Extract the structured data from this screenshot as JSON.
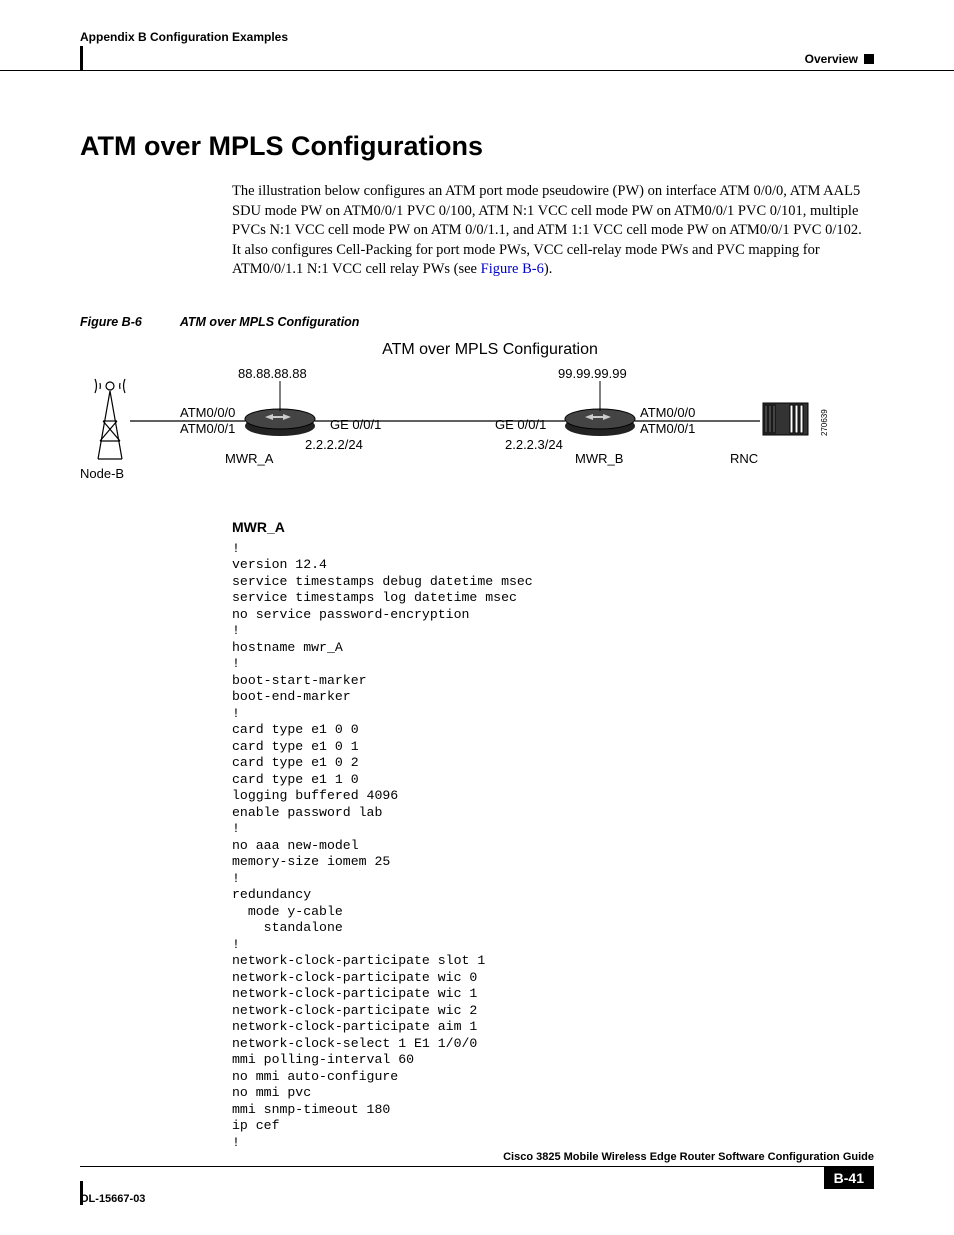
{
  "header": {
    "left": "Appendix B      Configuration Examples",
    "right": "Overview"
  },
  "heading": "ATM over MPLS Configurations",
  "intro_part1": "The illustration below configures an ATM port mode pseudowire (PW) on interface ATM 0/0/0, ATM AAL5 SDU mode PW on ATM0/0/1 PVC 0/100, ATM N:1 VCC cell mode PW on ATM0/0/1 PVC 0/101, multiple PVCs N:1 VCC cell mode PW on ATM 0/0/1.1, and ATM 1:1 VCC cell mode PW on ATM0/0/1 PVC 0/102. It also configures Cell-Packing for port mode PWs, VCC cell-relay mode PWs and PVC mapping for ATM0/0/1.1 N:1 VCC cell relay PWs (see ",
  "intro_link": "Figure B-6",
  "intro_part2": ").",
  "figure": {
    "num": "Figure B-6",
    "title": "ATM over MPLS Configuration"
  },
  "diagram": {
    "title": "ATM over MPLS Configuration",
    "ip_a": "88.88.88.88",
    "ip_b": "99.99.99.99",
    "atm00": "ATM0/0/0",
    "atm01": "ATM0/0/1",
    "ge": "GE 0/0/1",
    "sub_a": "2.2.2.2/24",
    "sub_b": "2.2.2.3/24",
    "mwr_a": "MWR_A",
    "mwr_b": "MWR_B",
    "node_b": "Node-B",
    "rnc": "RNC",
    "fignum": "270639"
  },
  "sub_heading": "MWR_A",
  "code": "!\nversion 12.4\nservice timestamps debug datetime msec\nservice timestamps log datetime msec\nno service password-encryption\n!\nhostname mwr_A\n!\nboot-start-marker\nboot-end-marker\n!\ncard type e1 0 0\ncard type e1 0 1\ncard type e1 0 2\ncard type e1 1 0\nlogging buffered 4096\nenable password lab\n!\nno aaa new-model\nmemory-size iomem 25\n!\nredundancy\n  mode y-cable\n    standalone\n!\nnetwork-clock-participate slot 1\nnetwork-clock-participate wic 0\nnetwork-clock-participate wic 1\nnetwork-clock-participate wic 2\nnetwork-clock-participate aim 1\nnetwork-clock-select 1 E1 1/0/0\nmmi polling-interval 60\nno mmi auto-configure\nno mmi pvc\nmmi snmp-timeout 180\nip cef\n!",
  "footer": {
    "title": "Cisco 3825 Mobile Wireless Edge Router Software Configuration Guide",
    "doc": "OL-15667-03",
    "page": "B-41"
  }
}
